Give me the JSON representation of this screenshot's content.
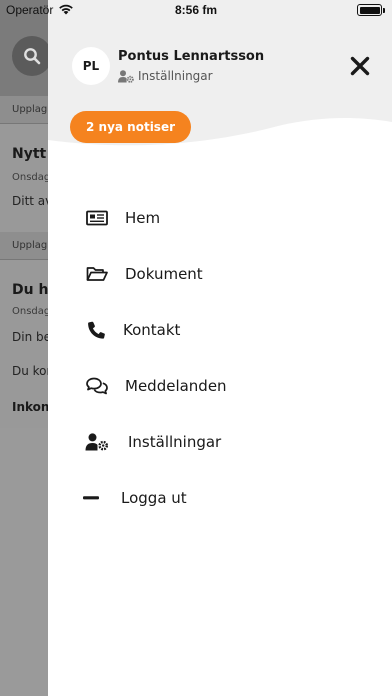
{
  "status_bar": {
    "carrier": "Operatör",
    "time": "8:56 fm"
  },
  "background": {
    "sections": [
      {
        "label": "Upplag",
        "title": "Nytt",
        "date": "Onsdag",
        "lines": [
          "Ditt av"
        ]
      },
      {
        "label": "Upplag",
        "title": "Du ha",
        "date": "Onsdag",
        "lines": [
          "Din be",
          "Du kor"
        ],
        "bold_line": "Inkon"
      }
    ]
  },
  "drawer": {
    "avatar_initials": "PL",
    "user_name": "Pontus Lennartsson",
    "settings_label": "Inställningar",
    "notifications_label": "2 nya notiser",
    "accent_color": "#f5831f",
    "menu": [
      {
        "label": "Hem",
        "icon": "newspaper-icon"
      },
      {
        "label": "Dokument",
        "icon": "folder-open-icon"
      },
      {
        "label": "Kontakt",
        "icon": "phone-icon"
      },
      {
        "label": "Meddelanden",
        "icon": "chat-bubbles-icon"
      },
      {
        "label": "Inställningar",
        "icon": "user-cog-icon"
      },
      {
        "label": "Logga ut",
        "icon": "minus-icon"
      }
    ]
  }
}
